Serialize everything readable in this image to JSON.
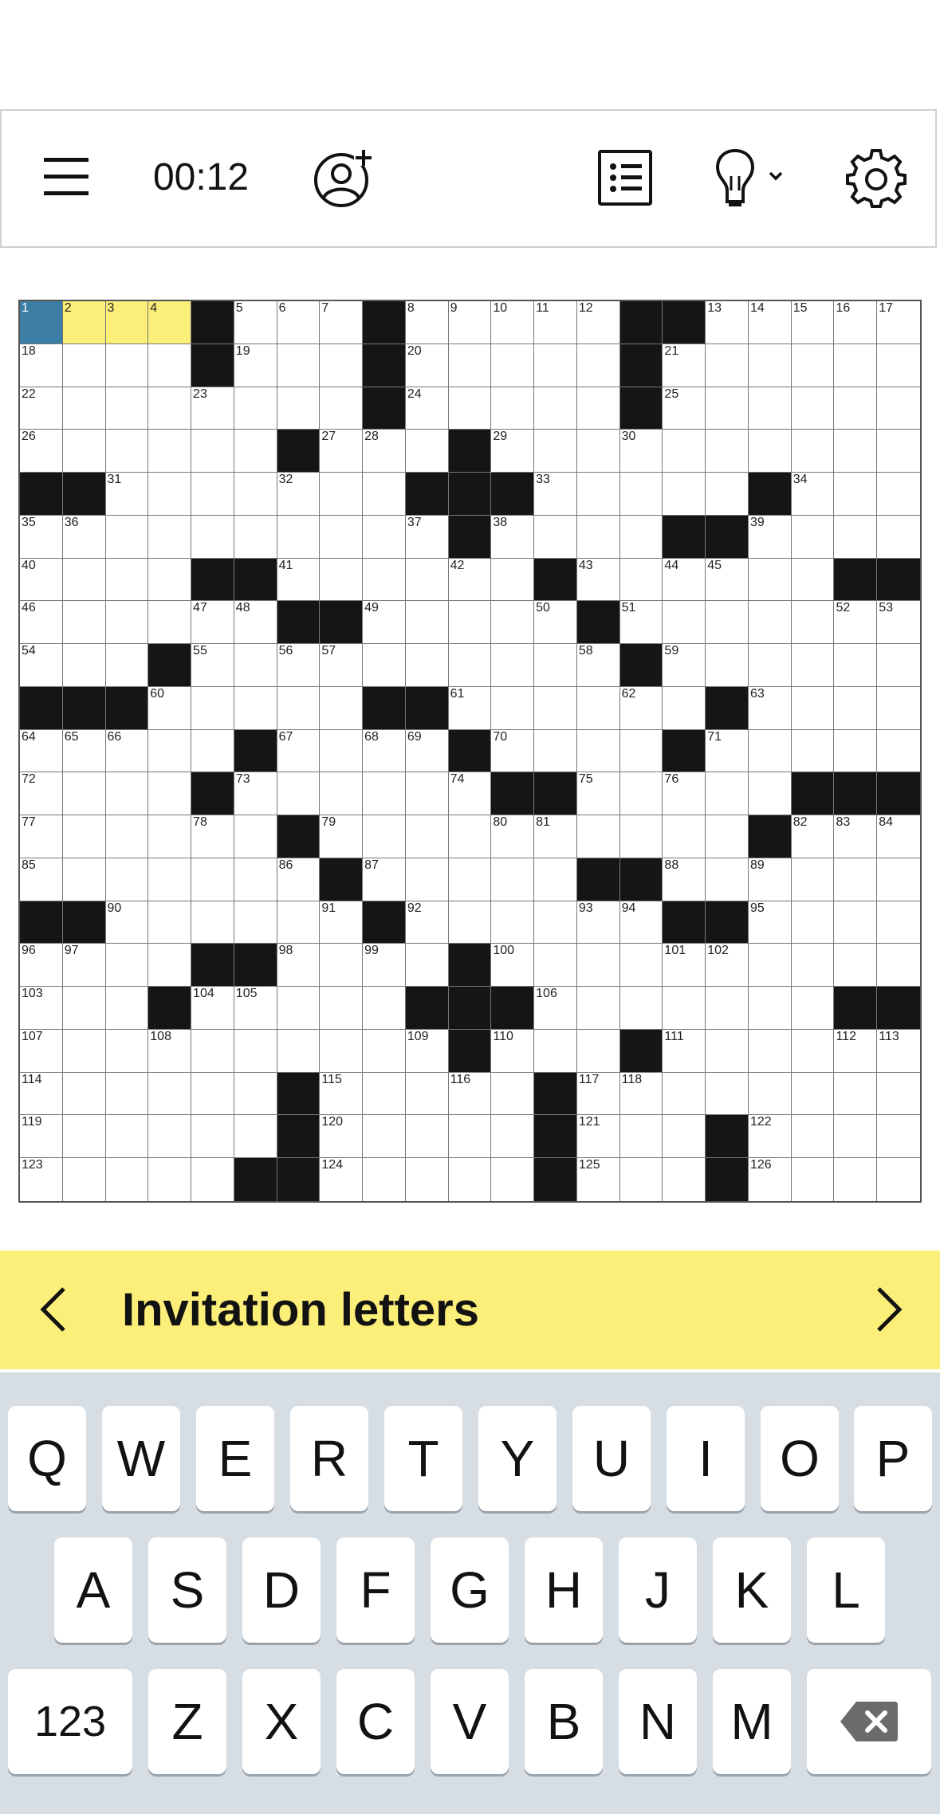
{
  "toolbar": {
    "timer": "00:12",
    "icons": [
      "menu-icon",
      "add-friend-icon",
      "clue-list-icon",
      "hint-icon",
      "settings-icon"
    ]
  },
  "puzzle": {
    "size": 21,
    "black_cells": [
      [
        0,
        4
      ],
      [
        0,
        8
      ],
      [
        0,
        14
      ],
      [
        0,
        15
      ],
      [
        1,
        4
      ],
      [
        1,
        8
      ],
      [
        1,
        14
      ],
      [
        2,
        8
      ],
      [
        2,
        14
      ],
      [
        3,
        6
      ],
      [
        3,
        10
      ],
      [
        4,
        0
      ],
      [
        4,
        1
      ],
      [
        4,
        9
      ],
      [
        4,
        10
      ],
      [
        4,
        11
      ],
      [
        4,
        17
      ],
      [
        5,
        10
      ],
      [
        5,
        15
      ],
      [
        5,
        16
      ],
      [
        6,
        4
      ],
      [
        6,
        5
      ],
      [
        6,
        12
      ],
      [
        6,
        19
      ],
      [
        6,
        20
      ],
      [
        7,
        6
      ],
      [
        7,
        7
      ],
      [
        7,
        13
      ],
      [
        8,
        3
      ],
      [
        8,
        14
      ],
      [
        9,
        0
      ],
      [
        9,
        1
      ],
      [
        9,
        2
      ],
      [
        9,
        8
      ],
      [
        9,
        9
      ],
      [
        9,
        16
      ],
      [
        10,
        5
      ],
      [
        10,
        10
      ],
      [
        10,
        15
      ],
      [
        11,
        4
      ],
      [
        11,
        11
      ],
      [
        11,
        12
      ],
      [
        11,
        18
      ],
      [
        11,
        19
      ],
      [
        11,
        20
      ],
      [
        12,
        6
      ],
      [
        12,
        17
      ],
      [
        13,
        7
      ],
      [
        13,
        13
      ],
      [
        13,
        14
      ],
      [
        14,
        0
      ],
      [
        14,
        1
      ],
      [
        14,
        8
      ],
      [
        14,
        15
      ],
      [
        14,
        16
      ],
      [
        15,
        4
      ],
      [
        15,
        5
      ],
      [
        15,
        10
      ],
      [
        16,
        3
      ],
      [
        16,
        9
      ],
      [
        16,
        10
      ],
      [
        16,
        11
      ],
      [
        16,
        19
      ],
      [
        16,
        20
      ],
      [
        17,
        10
      ],
      [
        17,
        14
      ],
      [
        18,
        6
      ],
      [
        18,
        12
      ],
      [
        19,
        6
      ],
      [
        19,
        12
      ],
      [
        19,
        16
      ],
      [
        20,
        5
      ],
      [
        20,
        6
      ],
      [
        20,
        12
      ],
      [
        20,
        16
      ]
    ],
    "selected_cell": [
      0,
      0
    ],
    "highlighted_word": [
      [
        0,
        0
      ],
      [
        0,
        1
      ],
      [
        0,
        2
      ],
      [
        0,
        3
      ]
    ],
    "numbers": [
      [
        0,
        0,
        "1"
      ],
      [
        0,
        1,
        "2"
      ],
      [
        0,
        2,
        "3"
      ],
      [
        0,
        3,
        "4"
      ],
      [
        0,
        5,
        "5"
      ],
      [
        0,
        6,
        "6"
      ],
      [
        0,
        7,
        "7"
      ],
      [
        0,
        9,
        "8"
      ],
      [
        0,
        10,
        "9"
      ],
      [
        0,
        11,
        "10"
      ],
      [
        0,
        12,
        "11"
      ],
      [
        0,
        13,
        "12"
      ],
      [
        0,
        16,
        "13"
      ],
      [
        0,
        17,
        "14"
      ],
      [
        0,
        18,
        "15"
      ],
      [
        0,
        19,
        "16"
      ],
      [
        0,
        20,
        "17"
      ],
      [
        1,
        0,
        "18"
      ],
      [
        1,
        5,
        "19"
      ],
      [
        1,
        9,
        "20"
      ],
      [
        1,
        15,
        "21"
      ],
      [
        2,
        0,
        "22"
      ],
      [
        2,
        4,
        "23"
      ],
      [
        2,
        9,
        "24"
      ],
      [
        2,
        15,
        "25"
      ],
      [
        3,
        0,
        "26"
      ],
      [
        3,
        7,
        "27"
      ],
      [
        3,
        8,
        "28"
      ],
      [
        3,
        11,
        "29"
      ],
      [
        3,
        14,
        "30"
      ],
      [
        4,
        2,
        "31"
      ],
      [
        4,
        6,
        "32"
      ],
      [
        4,
        12,
        "33"
      ],
      [
        4,
        18,
        "34"
      ],
      [
        5,
        0,
        "35"
      ],
      [
        5,
        1,
        "36"
      ],
      [
        5,
        9,
        "37"
      ],
      [
        5,
        11,
        "38"
      ],
      [
        5,
        17,
        "39"
      ],
      [
        6,
        0,
        "40"
      ],
      [
        6,
        6,
        "41"
      ],
      [
        6,
        10,
        "42"
      ],
      [
        6,
        13,
        "43"
      ],
      [
        6,
        15,
        "44"
      ],
      [
        6,
        16,
        "45"
      ],
      [
        7,
        0,
        "46"
      ],
      [
        7,
        4,
        "47"
      ],
      [
        7,
        5,
        "48"
      ],
      [
        7,
        8,
        "49"
      ],
      [
        7,
        12,
        "50"
      ],
      [
        7,
        14,
        "51"
      ],
      [
        7,
        19,
        "52"
      ],
      [
        7,
        20,
        "53"
      ],
      [
        8,
        0,
        "54"
      ],
      [
        8,
        4,
        "55"
      ],
      [
        8,
        6,
        "56"
      ],
      [
        8,
        7,
        "57"
      ],
      [
        8,
        13,
        "58"
      ],
      [
        8,
        15,
        "59"
      ],
      [
        9,
        3,
        "60"
      ],
      [
        9,
        10,
        "61"
      ],
      [
        9,
        14,
        "62"
      ],
      [
        9,
        17,
        "63"
      ],
      [
        10,
        0,
        "64"
      ],
      [
        10,
        1,
        "65"
      ],
      [
        10,
        2,
        "66"
      ],
      [
        10,
        6,
        "67"
      ],
      [
        10,
        8,
        "68"
      ],
      [
        10,
        9,
        "69"
      ],
      [
        10,
        11,
        "70"
      ],
      [
        10,
        16,
        "71"
      ],
      [
        11,
        0,
        "72"
      ],
      [
        11,
        5,
        "73"
      ],
      [
        11,
        10,
        "74"
      ],
      [
        11,
        13,
        "75"
      ],
      [
        11,
        15,
        "76"
      ],
      [
        12,
        0,
        "77"
      ],
      [
        12,
        4,
        "78"
      ],
      [
        12,
        7,
        "79"
      ],
      [
        12,
        11,
        "80"
      ],
      [
        12,
        12,
        "81"
      ],
      [
        12,
        18,
        "82"
      ],
      [
        12,
        19,
        "83"
      ],
      [
        12,
        20,
        "84"
      ],
      [
        13,
        0,
        "85"
      ],
      [
        13,
        6,
        "86"
      ],
      [
        13,
        8,
        "87"
      ],
      [
        13,
        15,
        "88"
      ],
      [
        13,
        17,
        "89"
      ],
      [
        14,
        2,
        "90"
      ],
      [
        14,
        7,
        "91"
      ],
      [
        14,
        9,
        "92"
      ],
      [
        14,
        13,
        "93"
      ],
      [
        14,
        14,
        "94"
      ],
      [
        14,
        17,
        "95"
      ],
      [
        15,
        0,
        "96"
      ],
      [
        15,
        1,
        "97"
      ],
      [
        15,
        6,
        "98"
      ],
      [
        15,
        8,
        "99"
      ],
      [
        15,
        11,
        "100"
      ],
      [
        15,
        15,
        "101"
      ],
      [
        15,
        16,
        "102"
      ],
      [
        16,
        0,
        "103"
      ],
      [
        16,
        4,
        "104"
      ],
      [
        16,
        5,
        "105"
      ],
      [
        16,
        12,
        "106"
      ],
      [
        17,
        0,
        "107"
      ],
      [
        17,
        3,
        "108"
      ],
      [
        17,
        9,
        "109"
      ],
      [
        17,
        11,
        "110"
      ],
      [
        17,
        15,
        "111"
      ],
      [
        17,
        19,
        "112"
      ],
      [
        17,
        20,
        "113"
      ],
      [
        18,
        0,
        "114"
      ],
      [
        18,
        7,
        "115"
      ],
      [
        18,
        10,
        "116"
      ],
      [
        18,
        13,
        "117"
      ],
      [
        18,
        14,
        "118"
      ],
      [
        19,
        0,
        "119"
      ],
      [
        19,
        7,
        "120"
      ],
      [
        19,
        13,
        "121"
      ],
      [
        19,
        17,
        "122"
      ],
      [
        20,
        0,
        "123"
      ],
      [
        20,
        7,
        "124"
      ],
      [
        20,
        13,
        "125"
      ],
      [
        20,
        17,
        "126"
      ]
    ]
  },
  "clue": {
    "text": "Invitation letters"
  },
  "keyboard": {
    "row1": [
      "Q",
      "W",
      "E",
      "R",
      "T",
      "Y",
      "U",
      "I",
      "O",
      "P"
    ],
    "row2": [
      "A",
      "S",
      "D",
      "F",
      "G",
      "H",
      "J",
      "K",
      "L"
    ],
    "row3": [
      "Z",
      "X",
      "C",
      "V",
      "B",
      "N",
      "M"
    ],
    "numbers_key": "123",
    "delete_icon": "backspace-icon"
  },
  "colors": {
    "selected": "#3c7ea6",
    "word": "#fbee79",
    "black": "#151515",
    "keyboard_bg": "#d6dde3"
  }
}
